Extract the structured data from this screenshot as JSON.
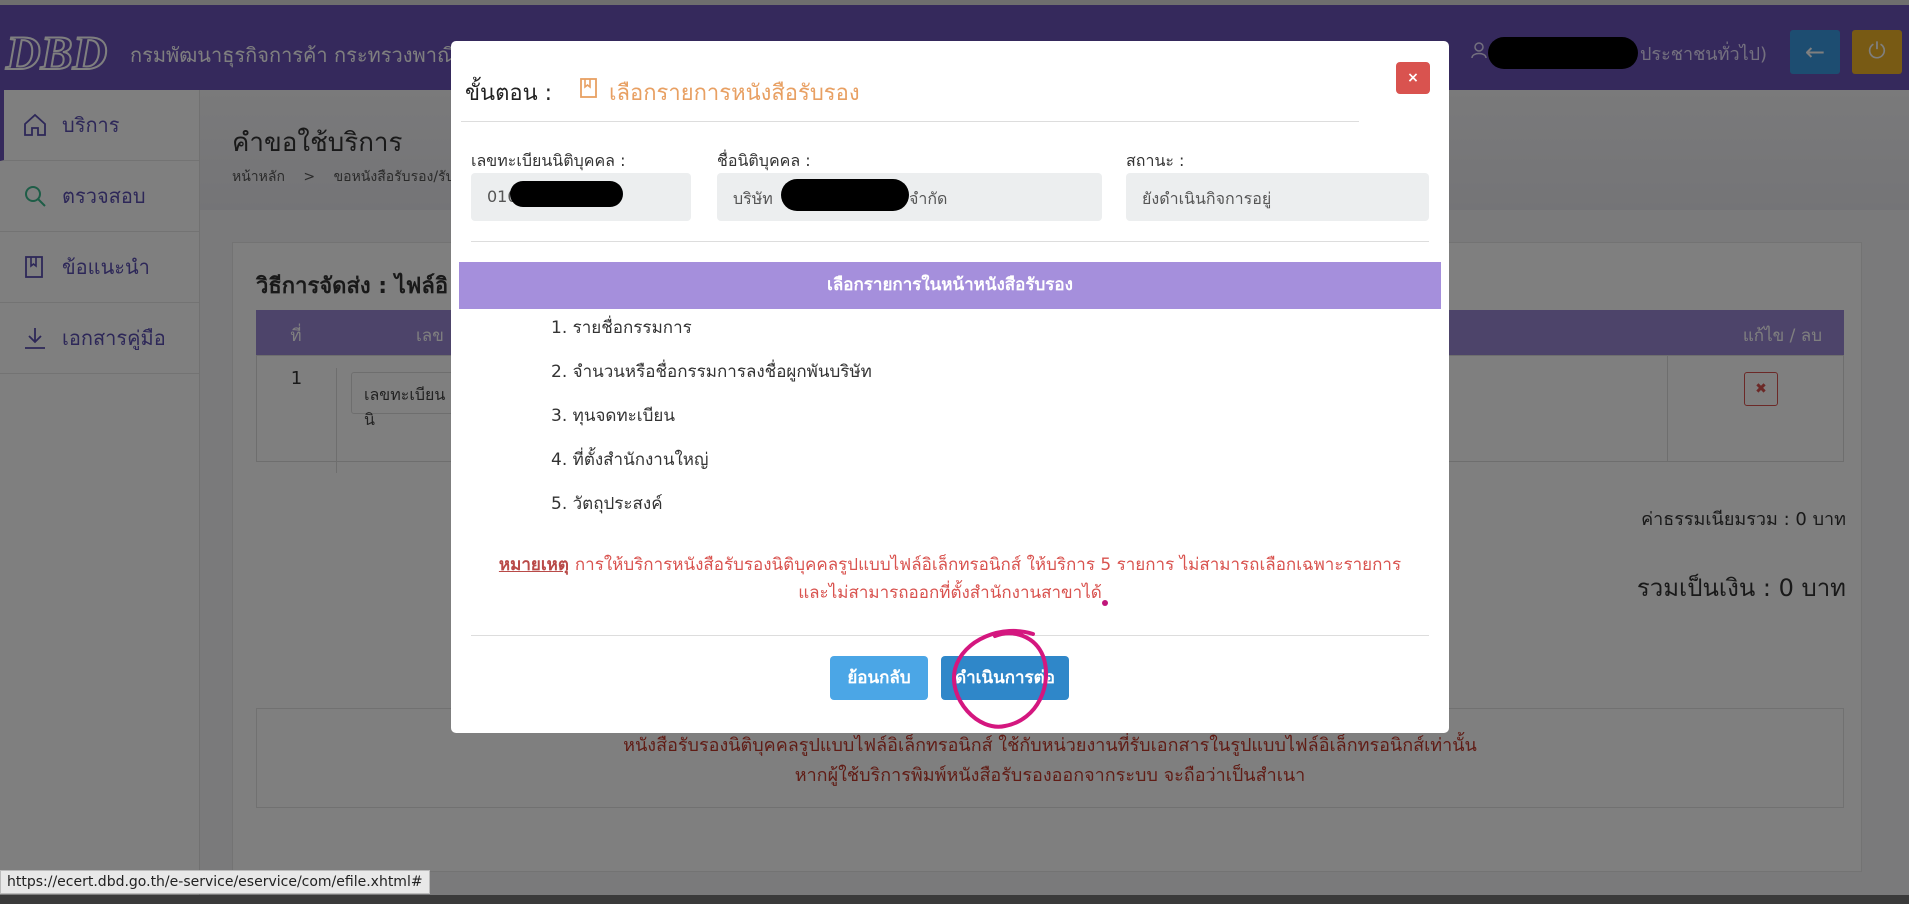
{
  "header": {
    "org_name": "กรมพัฒนาธุรกิจการค้า กระทรวงพาณิชย์",
    "user_role": "ประชาชนทั่วไป)",
    "colors": {
      "primary": "#6a53b8",
      "back_btn": "#3b9be3",
      "power_btn": "#f0b428"
    }
  },
  "sidebar": {
    "items": [
      {
        "label": "บริการ",
        "icon": "home-icon"
      },
      {
        "label": "ตรวจสอบ",
        "icon": "search-icon"
      },
      {
        "label": "ข้อแนะนำ",
        "icon": "book-icon"
      },
      {
        "label": "เอกสารคู่มือ",
        "icon": "download-icon"
      }
    ]
  },
  "page": {
    "title": "คำขอใช้บริการ",
    "breadcrumb": [
      "หน้าหลัก",
      ">",
      "ขอหนังสือรับรอง/รับร"
    ],
    "card_title": "วิธีการจัดส่ง : ไฟล์อิ",
    "table": {
      "headers": [
        "ที่",
        "เลข",
        "แก้ไข / ลบ"
      ],
      "rows": [
        {
          "no": "1",
          "field": "เลขทะเบียนนิ"
        }
      ]
    },
    "fee_total": "ค่าธรรมเนียมรวม : 0 บาท",
    "grand_total": "รวมเป็นเงิน : 0 บาท",
    "notice": [
      "หนังสือรับรองนิติบุคคลรูปแบบไฟล์อิเล็กทรอนิกส์ ใช้กับหน่วยงานที่รับเอกสารในรูปแบบไฟล์อิเล็กทรอนิกส์เท่านั้น",
      "หากผู้ใช้บริการพิมพ์หนังสือรับรองออกจากระบบ จะถือว่าเป็นสำเนา"
    ]
  },
  "status_url": "https://ecert.dbd.go.th/e-service/eservice/com/efile.xhtml#",
  "modal": {
    "step_label": "ขั้นตอน :",
    "step_title": "เลือกรายการหนังสือรับรอง",
    "close_label": "×",
    "fields": {
      "reg_no_label": "เลขทะเบียนนิติบุคคล :",
      "reg_no_value": "010",
      "name_label": "ชื่อนิติบุคคล :",
      "name_prefix": "บริษัท",
      "name_suffix": "จำกัด",
      "status_label": "สถานะ :",
      "status_value": "ยังดำเนินกิจการอยู่"
    },
    "banner": "เลือกรายการในหน้าหนังสือรับรอง",
    "items": [
      "1. รายชื่อกรรมการ",
      "2. จำนวนหรือชื่อกรรมการลงชื่อผูกพันบริษัท",
      "3. ทุนจดทะเบียน",
      "4. ที่ตั้งสำนักงานใหญ่",
      "5. วัตถุประสงค์"
    ],
    "note_keyword": "หมายเหตุ",
    "note_line1": "การให้บริการหนังสือรับรองนิติบุคคลรูปแบบไฟล์อิเล็กทรอนิกส์ ให้บริการ 5 รายการ ไม่สามารถเลือกเฉพาะรายการ",
    "note_line2": "และไม่สามารถออกที่ตั้งสำนักงานสาขาได้",
    "back_button": "ย้อนกลับ",
    "next_button": "ดำเนินการต่อ"
  }
}
